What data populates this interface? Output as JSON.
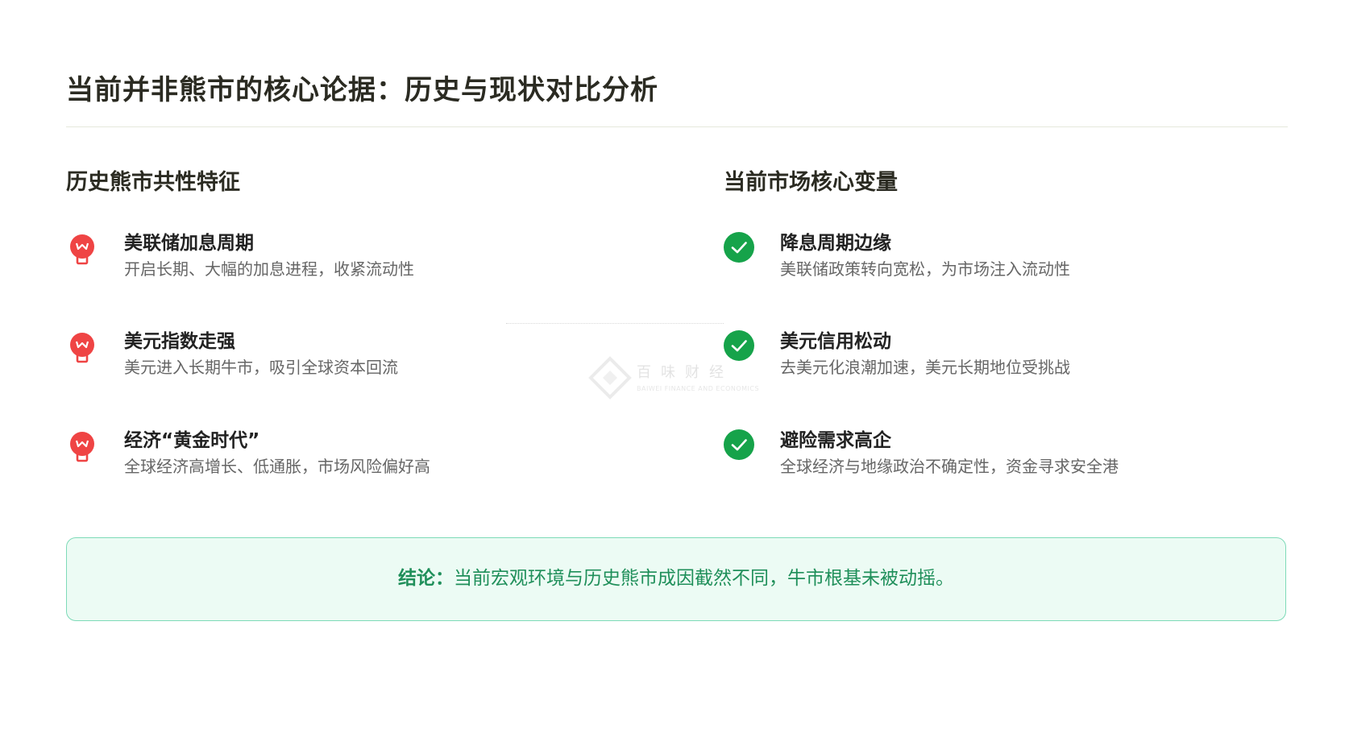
{
  "title": "当前并非熊市的核心论据：历史与现状对比分析",
  "left": {
    "heading": "历史熊市共性特征",
    "items": [
      {
        "title": "美联储加息周期",
        "desc": "开启长期、大幅的加息进程，收紧流动性",
        "icon": "alarm-icon"
      },
      {
        "title": "美元指数走强",
        "desc": "美元进入长期牛市，吸引全球资本回流",
        "icon": "alarm-icon"
      },
      {
        "title": "经济“黄金时代”",
        "desc": "全球经济高增长、低通胀，市场风险偏好高",
        "icon": "alarm-icon"
      }
    ]
  },
  "right": {
    "heading": "当前市场核心变量",
    "items": [
      {
        "title": "降息周期边缘",
        "desc": "美联储政策转向宽松，为市场注入流动性",
        "icon": "check-icon"
      },
      {
        "title": "美元信用松动",
        "desc": "去美元化浪潮加速，美元长期地位受挑战",
        "icon": "check-icon"
      },
      {
        "title": "避险需求高企",
        "desc": "全球经济与地缘政治不确定性，资金寻求安全港",
        "icon": "check-icon"
      }
    ]
  },
  "watermark": {
    "cn": "百味财经",
    "en": "BAIWEI FINANCE AND ECONOMICS"
  },
  "conclusion": {
    "label": "结论：",
    "text": "当前宏观环境与历史熊市成因截然不同，牛市根基未被动摇。"
  },
  "colors": {
    "alarm": "#ef4444",
    "check": "#16a34a",
    "conclusion_text": "#1f8f5a",
    "conclusion_bg": "#ecfbf4",
    "conclusion_border": "#7edab8"
  }
}
